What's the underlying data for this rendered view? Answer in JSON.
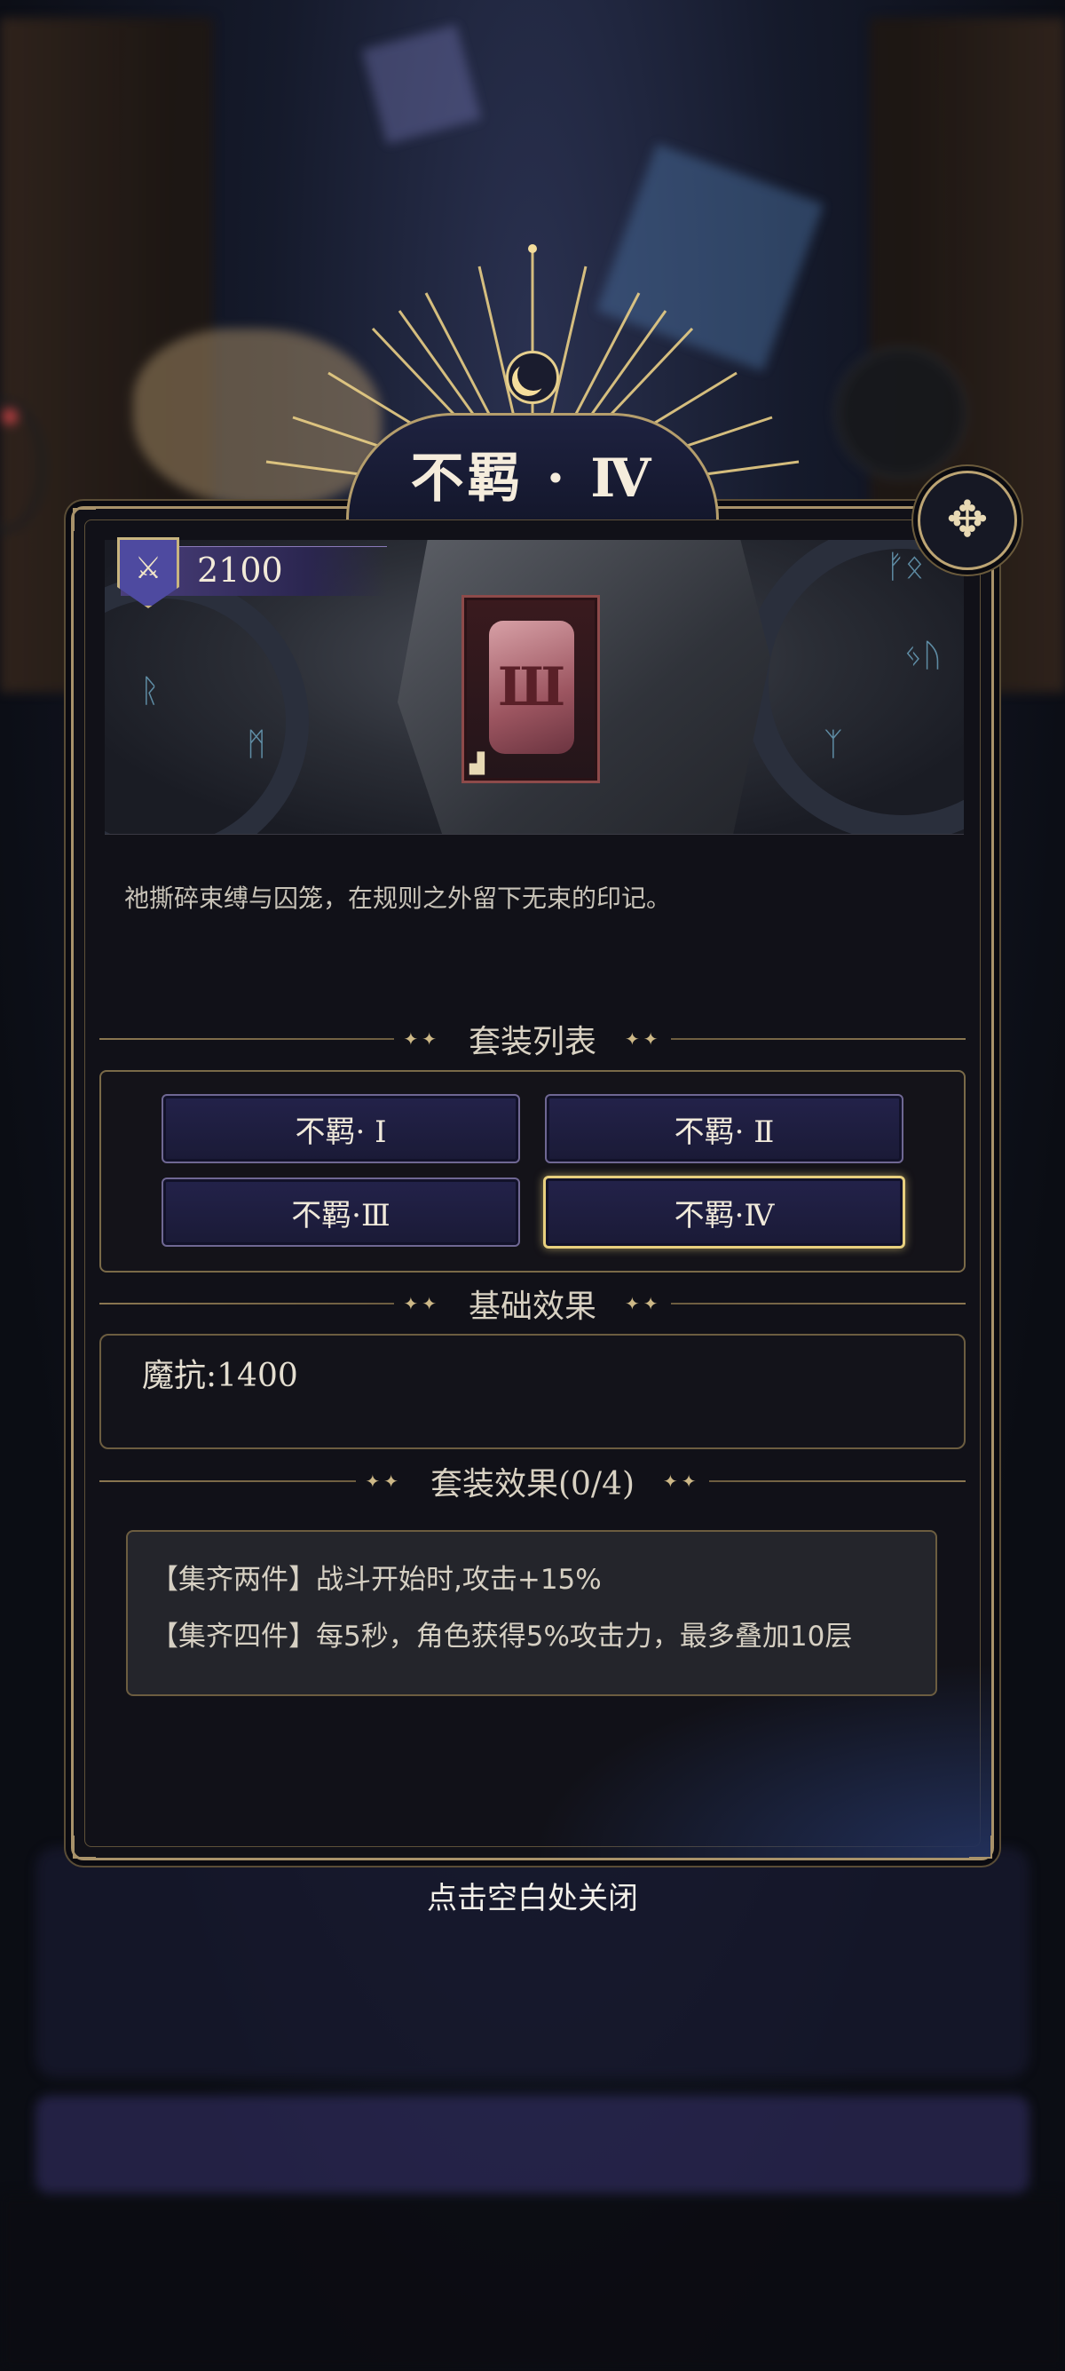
{
  "title": "不羁 · Ⅳ",
  "score": "2100",
  "description": "祂撕碎束缚与囚笼，在规则之外留下无束的印记。",
  "sections": {
    "set_list": "套装列表",
    "base_effect": "基础效果",
    "set_effect": "套装效果(0/4)"
  },
  "set_list": [
    {
      "label": "不羁· Ⅰ",
      "active": false
    },
    {
      "label": "不羁· Ⅱ",
      "active": false
    },
    {
      "label": "不羁·Ⅲ",
      "active": false
    },
    {
      "label": "不羁·Ⅳ",
      "active": true
    }
  ],
  "base_effect": "魔抗:1400",
  "set_effects": [
    "【集齐两件】战斗开始时,攻击+15%",
    "【集齐四件】每5秒，角色获得5%攻击力，最多叠加10层"
  ],
  "close_hint": "点击空白处关闭",
  "icons": {
    "close": "expand-arrows-icon",
    "shield": "crossed-swords-shield-icon",
    "emblem": "crescent-moon-icon",
    "item": "claw-rune-card-icon"
  },
  "colors": {
    "gold": "#c9b57f",
    "active_border": "#e8d07e",
    "panel_bg": "#111118",
    "button_bg": "#1a1a36"
  }
}
